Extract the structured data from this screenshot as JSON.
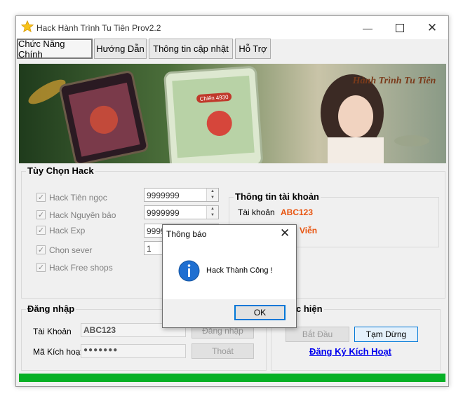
{
  "window": {
    "title": "Hack Hành Trình Tu Tiên  Prov2.2"
  },
  "tabs": [
    {
      "label": "Chức Năng Chính"
    },
    {
      "label": "Hướng Dẫn"
    },
    {
      "label": "Thông tin cập nhật"
    },
    {
      "label": "Hỗ Trợ"
    }
  ],
  "banner": {
    "logo_text": "Hành Trình Tu Tiên",
    "badge": "Chiến 4930"
  },
  "hack_options": {
    "title": "Tùy Chọn Hack",
    "items": [
      {
        "label": "Hack Tiên ngọc",
        "checked": true,
        "value": "9999999"
      },
      {
        "label": "Hack Nguyên bảo",
        "checked": true,
        "value": "9999999"
      },
      {
        "label": "Hack Exp",
        "checked": true,
        "value": "9999999"
      },
      {
        "label": "Chọn sever",
        "checked": true,
        "value": "1"
      },
      {
        "label": "Hack Free shops",
        "checked": true
      }
    ]
  },
  "account_info": {
    "title": "Thông tin tài khoản",
    "account_label": "Tài khoản",
    "account_value": "ABC123",
    "second_value": "Viễn"
  },
  "login": {
    "title": "Đăng nhập",
    "account_label": "Tài Khoản",
    "account_value": "ABC123",
    "activation_label": "Mã Kích hoạt",
    "activation_value": "●●●●●●●",
    "login_button": "Đăng nhập",
    "exit_button": "Thoát"
  },
  "execute": {
    "title": "c hiện",
    "start_button": "Bắt Đầu",
    "pause_button": "Tạm Dừng",
    "register_link": "Đăng Ký Kích Hoạt"
  },
  "progress": {
    "percent": 100
  },
  "dialog": {
    "title": "Thông báo",
    "message": "Hack Thành Công !",
    "ok_button": "OK"
  },
  "colors": {
    "accent": "#0078d7",
    "highlight_text": "#e8540f",
    "progress": "#06b025",
    "link": "#0000ee"
  }
}
